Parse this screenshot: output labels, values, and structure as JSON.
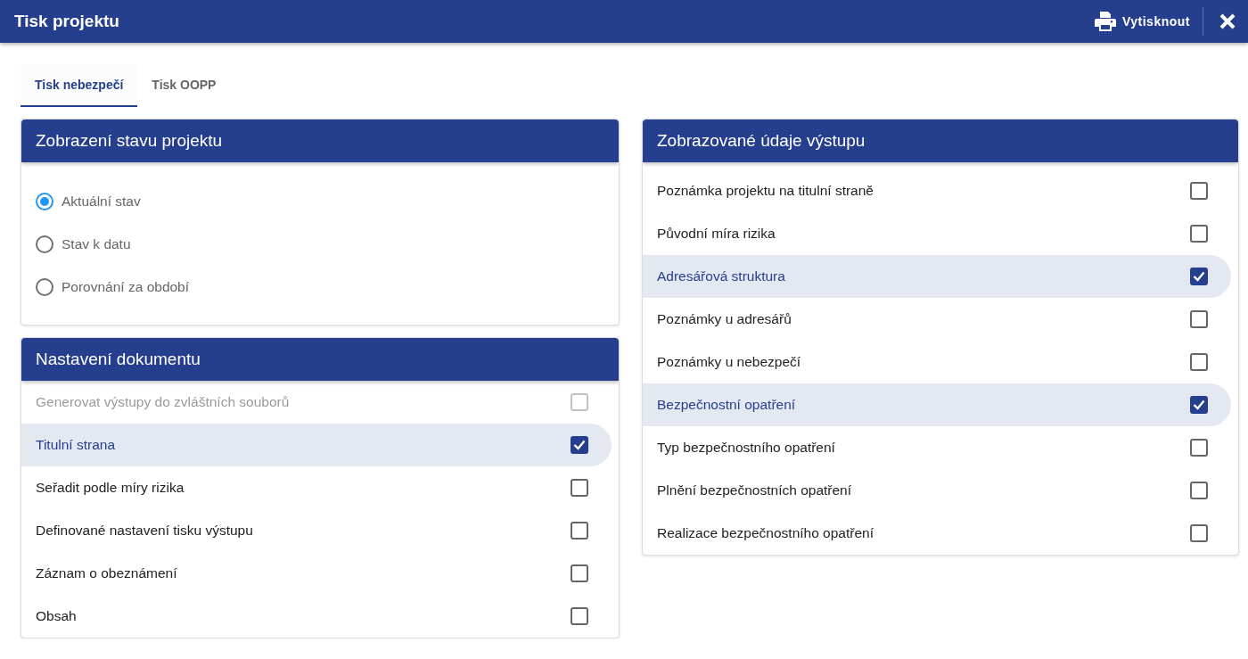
{
  "window": {
    "title": "Tisk projektu",
    "print_button": "Vytisknout"
  },
  "tabs": [
    {
      "label": "Tisk nebezpečí",
      "selected": true
    },
    {
      "label": "Tisk OOPP",
      "selected": false
    }
  ],
  "columns": [
    {
      "panels": [
        {
          "title": "Zobrazení stavu projektu",
          "kind": "radio",
          "items": [
            {
              "label": "Aktuální stav",
              "selected": true
            },
            {
              "label": "Stav k datu",
              "selected": false
            },
            {
              "label": "Porovnání za období",
              "selected": false
            }
          ]
        },
        {
          "title": "Nastavení dokumentu",
          "kind": "checkbox",
          "items": [
            {
              "label": "Generovat výstupy do zvláštních souborů",
              "checked": false,
              "disabled": true
            },
            {
              "label": "Titulní strana",
              "checked": true,
              "disabled": false
            },
            {
              "label": "Seřadit podle míry rizika",
              "checked": false,
              "disabled": false
            },
            {
              "label": "Definované nastavení tisku výstupu",
              "checked": false,
              "disabled": false
            },
            {
              "label": "Záznam o obeznámení",
              "checked": false,
              "disabled": false
            },
            {
              "label": "Obsah",
              "checked": false,
              "disabled": false
            }
          ]
        }
      ]
    },
    {
      "panels": [
        {
          "title": "Zobrazované údaje výstupu",
          "kind": "checkbox",
          "items": [
            {
              "label": "Poznámka projektu na titulní straně",
              "checked": false,
              "disabled": false
            },
            {
              "label": "Původní míra rizika",
              "checked": false,
              "disabled": false
            },
            {
              "label": "Adresářová struktura",
              "checked": true,
              "disabled": false
            },
            {
              "label": "Poznámky u adresářů",
              "checked": false,
              "disabled": false
            },
            {
              "label": "Poznámky u nebezpečí",
              "checked": false,
              "disabled": false
            },
            {
              "label": "Bezpečnostní opatření",
              "checked": true,
              "disabled": false
            },
            {
              "label": "Typ bezpečnostního opatření",
              "checked": false,
              "disabled": false
            },
            {
              "label": "Plnění bezpečnostních opatření",
              "checked": false,
              "disabled": false
            },
            {
              "label": "Realizace bezpečnostního opatření",
              "checked": false,
              "disabled": false
            }
          ]
        }
      ]
    }
  ]
}
